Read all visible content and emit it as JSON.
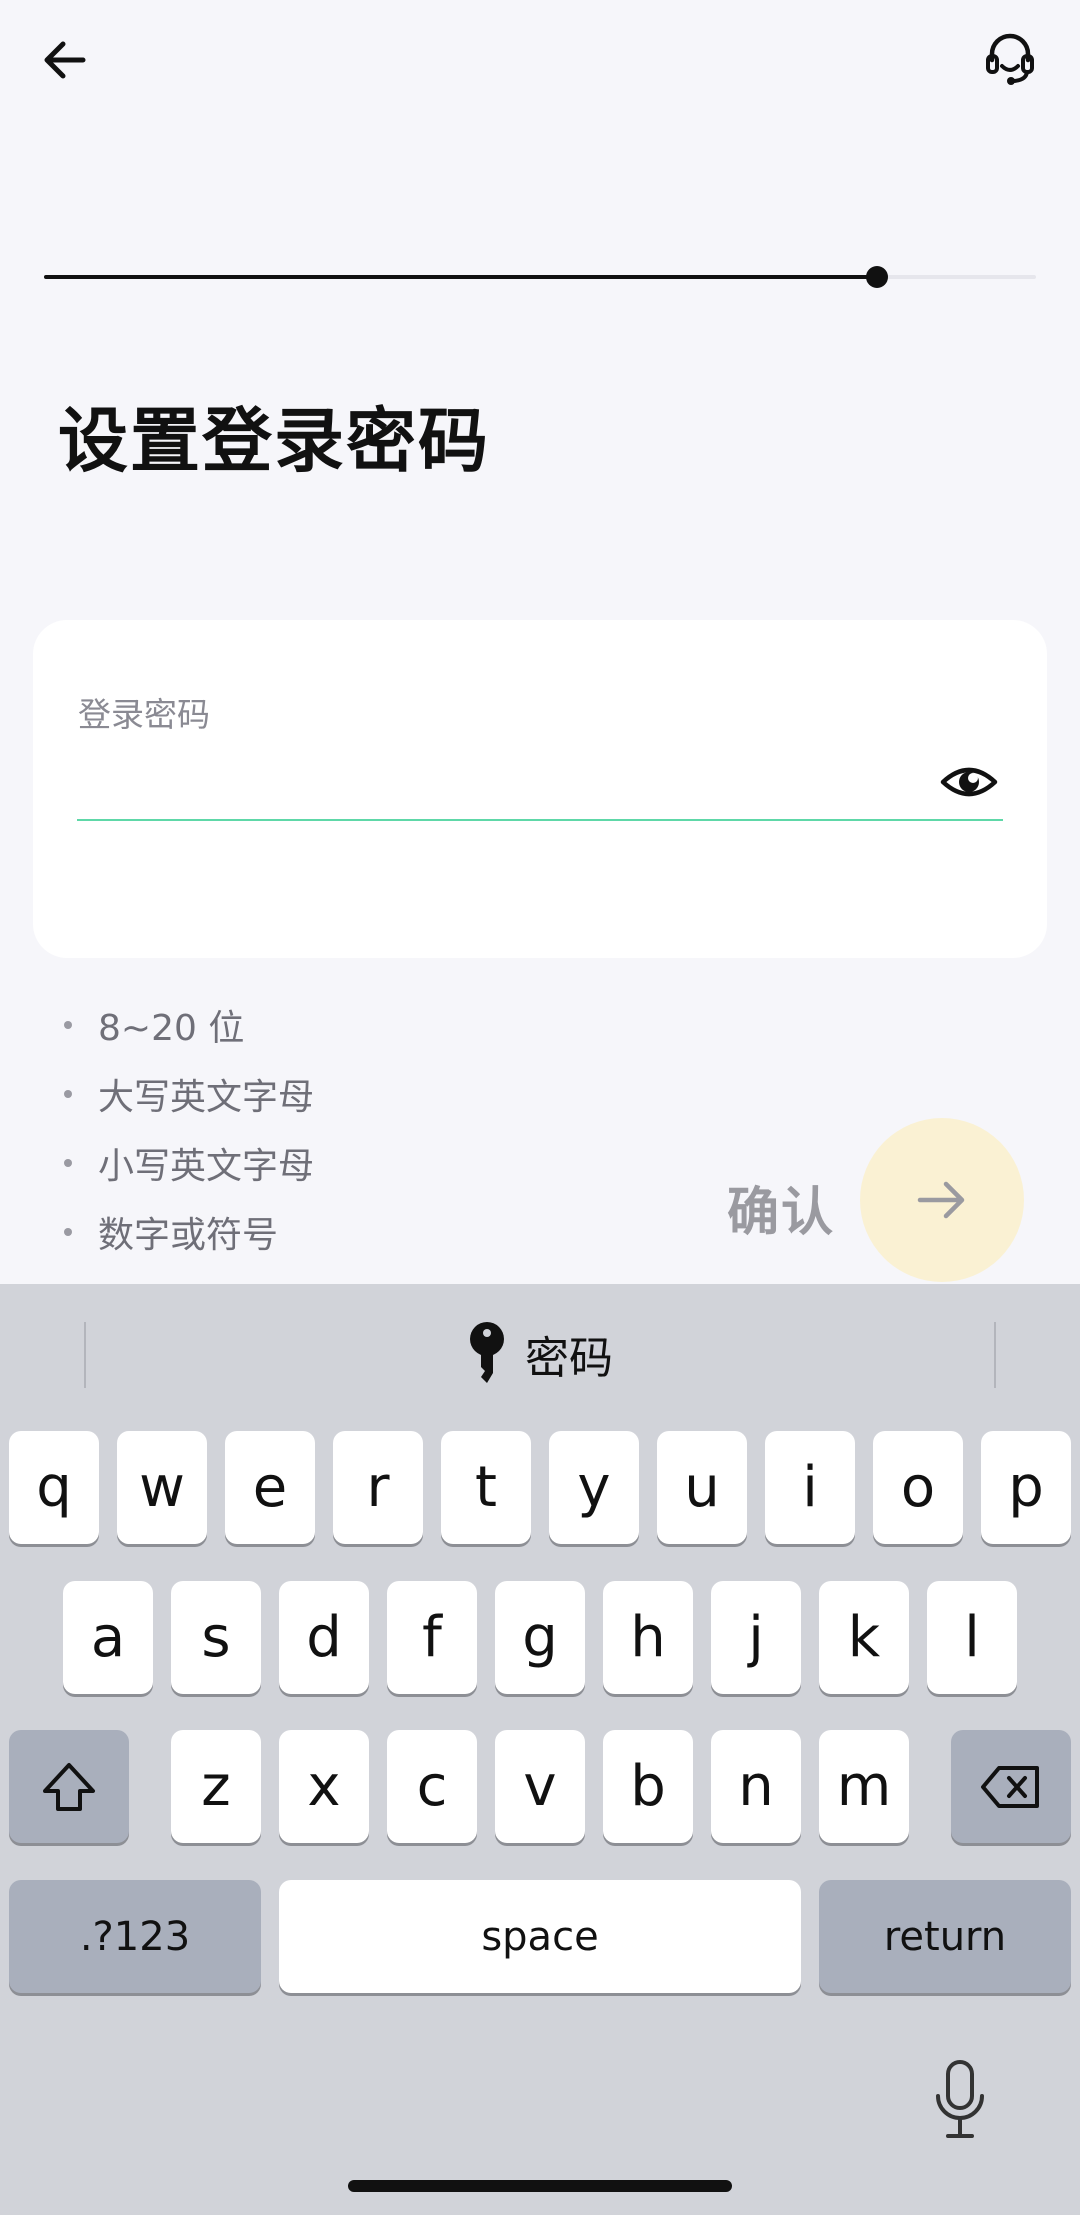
{
  "header": {
    "back_icon": "arrow-left-icon",
    "support_icon": "headset-icon"
  },
  "progress": {
    "fraction": 0.84
  },
  "page_title": "设置登录密码",
  "password_field": {
    "label": "登录密码",
    "value": "",
    "toggle_icon": "eye-icon"
  },
  "rules": [
    "8~20 位",
    "大写英文字母",
    "小写英文字母",
    "数字或符号"
  ],
  "confirm": {
    "label": "确认",
    "icon": "arrow-right-icon"
  },
  "keyboard": {
    "suggestion": {
      "icon": "key-icon",
      "label": "密码"
    },
    "row1": [
      "q",
      "w",
      "e",
      "r",
      "t",
      "y",
      "u",
      "i",
      "o",
      "p"
    ],
    "row2": [
      "a",
      "s",
      "d",
      "f",
      "g",
      "h",
      "j",
      "k",
      "l"
    ],
    "row3": [
      "z",
      "x",
      "c",
      "v",
      "b",
      "n",
      "m"
    ],
    "shift_icon": "shift-icon",
    "delete_icon": "backspace-icon",
    "numbers_label": ".?123",
    "space_label": "space",
    "return_label": "return",
    "mic_icon": "microphone-icon"
  }
}
